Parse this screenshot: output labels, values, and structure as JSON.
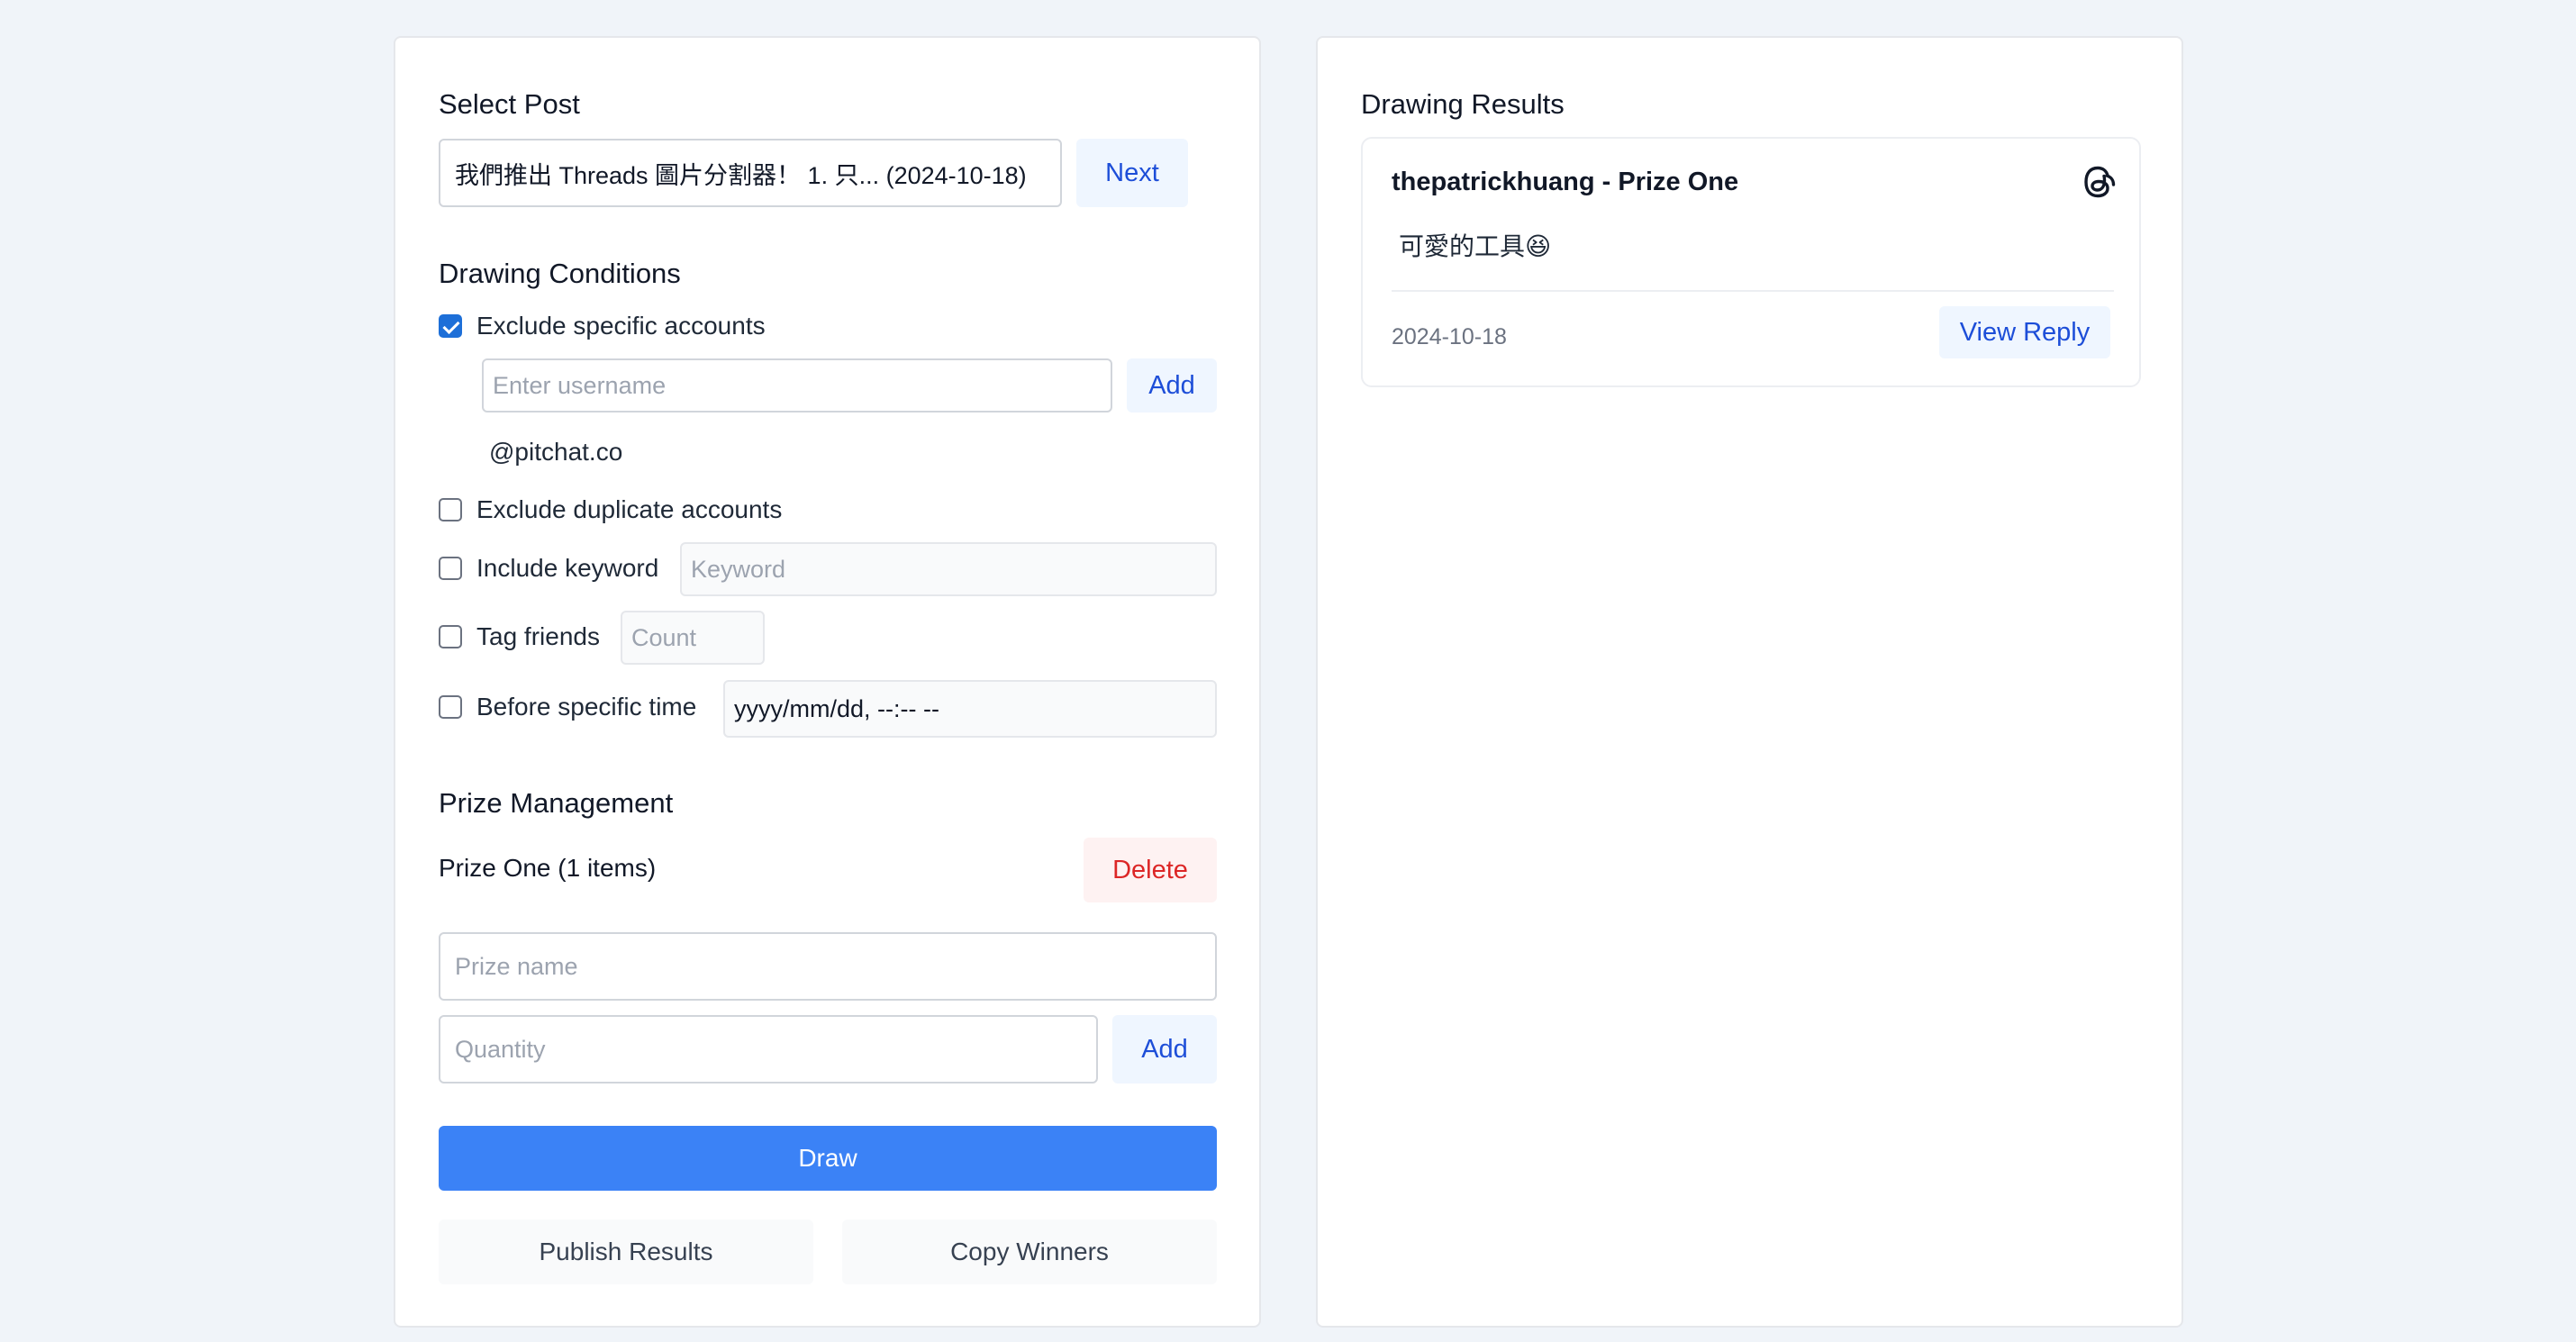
{
  "select_post": {
    "heading": "Select Post",
    "selected_post": "我們推出 Threads 圖片分割器！ 1. 只... (2024-10-18)",
    "next_label": "Next"
  },
  "conditions": {
    "heading": "Drawing Conditions",
    "exclude_specific": {
      "label": "Exclude specific accounts",
      "checked": true,
      "username_placeholder": "Enter username",
      "add_label": "Add",
      "excluded_accounts": [
        "@pitchat.co"
      ]
    },
    "exclude_duplicate": {
      "label": "Exclude duplicate accounts",
      "checked": false
    },
    "include_keyword": {
      "label": "Include keyword",
      "checked": false,
      "placeholder": "Keyword"
    },
    "tag_friends": {
      "label": "Tag friends",
      "checked": false,
      "placeholder": "Count"
    },
    "before_time": {
      "label": "Before specific time",
      "checked": false,
      "value": "yyyy/mm/dd, --:-- --"
    }
  },
  "prizes": {
    "heading": "Prize Management",
    "items": [
      {
        "label": "Prize One (1 items)",
        "delete_label": "Delete"
      }
    ],
    "prize_name_placeholder": "Prize name",
    "quantity_placeholder": "Quantity",
    "add_label": "Add"
  },
  "actions": {
    "draw_label": "Draw",
    "publish_label": "Publish Results",
    "copy_label": "Copy Winners"
  },
  "results": {
    "heading": "Drawing Results",
    "winners": [
      {
        "title": "thepatrickhuang - Prize One",
        "reply": "可愛的工具😆",
        "date": "2024-10-18",
        "view_label": "View Reply",
        "icon": "threads-icon"
      }
    ]
  },
  "colors": {
    "accent": "#3b82f6",
    "link_blue": "#1d4ed8",
    "danger": "#dc2626",
    "background": "#f0f4f9"
  }
}
